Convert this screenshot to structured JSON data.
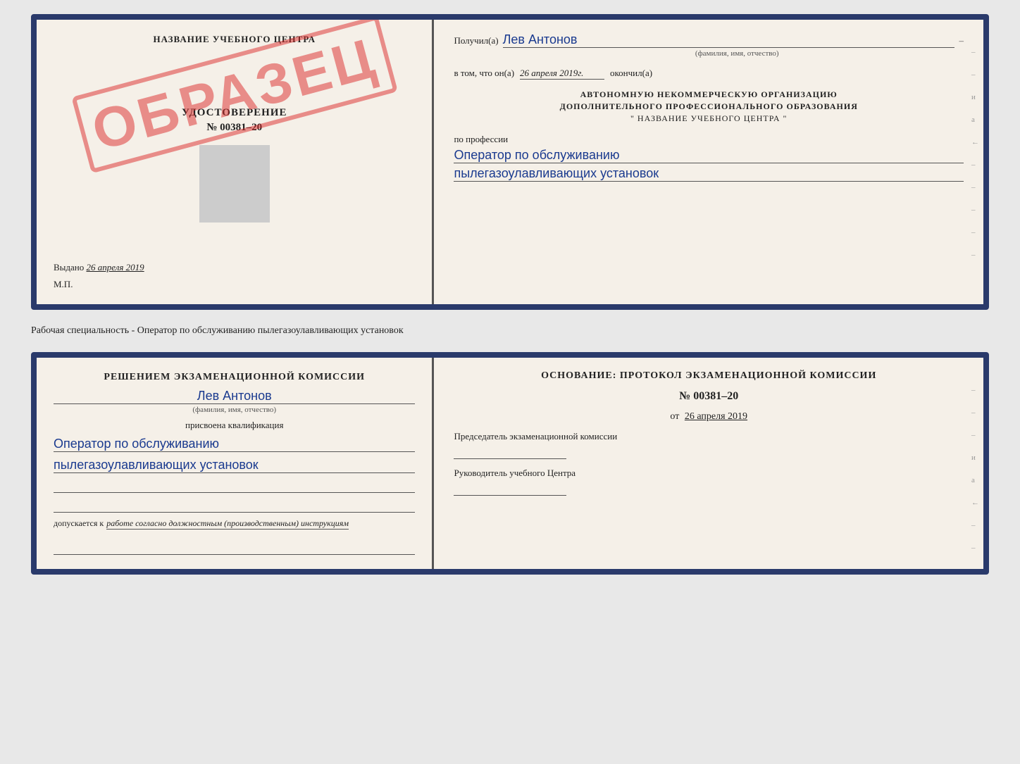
{
  "page": {
    "background": "#e8e8e8"
  },
  "topCard": {
    "left": {
      "orgName": "НАЗВАНИЕ УЧЕБНОГО ЦЕНТРА",
      "stampText": "ОБРАЗЕЦ",
      "certLabel": "УДОСТОВЕРЕНИЕ",
      "certNumber": "№ 00381–20",
      "issuedLabel": "Выдано",
      "issuedDate": "26 апреля 2019",
      "mpLabel": "М.П."
    },
    "right": {
      "receivedLabel": "Получил(а)",
      "receivedName": "Лев Антонов",
      "fioSubtitle": "(фамилия, имя, отчество)",
      "completedLabel": "в том, что он(а)",
      "completedDate": "26 апреля 2019г.",
      "completedSuffix": "окончил(а)",
      "orgLine1": "АВТОНОМНУЮ НЕКОММЕРЧЕСКУЮ ОРГАНИЗАЦИЮ",
      "orgLine2": "ДОПОЛНИТЕЛЬНОГО ПРОФЕССИОНАЛЬНОГО ОБРАЗОВАНИЯ",
      "orgLine3": "\"  НАЗВАНИЕ УЧЕБНОГО ЦЕНТРА  \"",
      "profLabel": "по профессии",
      "profValue1": "Оператор по обслуживанию",
      "profValue2": "пылегазоулавливающих установок"
    },
    "sideMarks": [
      "–",
      "–",
      "и",
      "а",
      "←",
      "–",
      "–",
      "–",
      "–",
      "–"
    ]
  },
  "middleText": "Рабочая специальность - Оператор по обслуживанию пылегазоулавливающих установок",
  "bottomCard": {
    "left": {
      "commissionTitle": "Решением экзаменационной комиссии",
      "personName": "Лев Антонов",
      "fioSubtitle": "(фамилия, имя, отчество)",
      "qualificationLabel": "присвоена квалификация",
      "qualValue1": "Оператор по обслуживанию",
      "qualValue2": "пылегазоулавливающих установок",
      "admissionLabel": "допускается к",
      "admissionValue": "работе согласно должностным (производственным) инструкциям"
    },
    "right": {
      "basisTitle": "Основание: протокол экзаменационной комиссии",
      "basisNumber": "№  00381–20",
      "basisDateLabel": "от",
      "basisDate": "26 апреля 2019",
      "chairmanLabel": "Председатель экзаменационной комиссии",
      "directorLabel": "Руководитель учебного Центра"
    },
    "sideMarks": [
      "–",
      "–",
      "–",
      "и",
      "а",
      "←",
      "–",
      "–",
      "–",
      "–"
    ]
  }
}
